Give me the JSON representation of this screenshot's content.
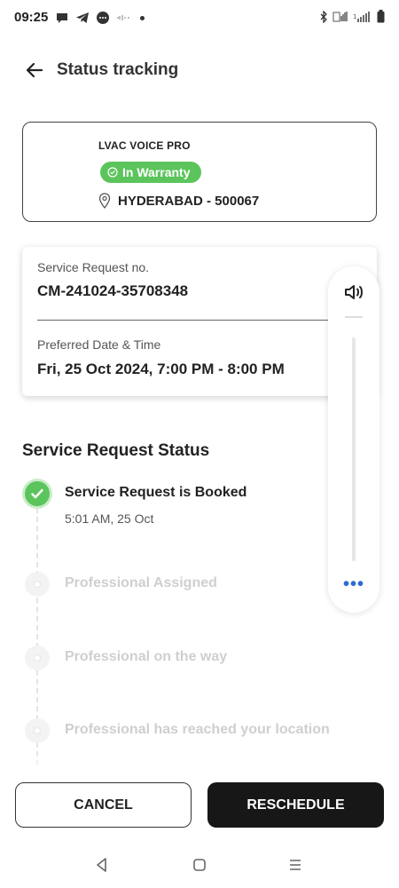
{
  "status_bar": {
    "time": "09:25",
    "icons": [
      "chat-bubble-icon",
      "telegram-icon",
      "messages-icon",
      "sound-wave-icon",
      "notification-dot-icon",
      "bluetooth-icon",
      "volte-icon",
      "signal-icon",
      "battery-icon"
    ]
  },
  "header": {
    "title": "Status tracking",
    "back_icon": "arrow-left-icon"
  },
  "product": {
    "name": "LVAC VOICE PRO",
    "warranty_label": "In Warranty",
    "location": "HYDERABAD - 500067"
  },
  "request": {
    "number_label": "Service Request no.",
    "number_value": "CM-241024-35708348",
    "datetime_label": "Preferred Date & Time",
    "datetime_value": "Fri, 25 Oct 2024, 7:00 PM - 8:00 PM"
  },
  "floating_toolbar": {
    "speaker_icon": "speaker-icon",
    "more_label": "•••"
  },
  "status_section": {
    "title": "Service Request Status",
    "steps": [
      {
        "title": "Service Request is Booked",
        "time": "5:01 AM, 25 Oct",
        "state": "done"
      },
      {
        "title": "Professional Assigned",
        "state": "pending"
      },
      {
        "title": "Professional on the way",
        "state": "pending"
      },
      {
        "title": "Professional has reached your location",
        "state": "pending"
      }
    ]
  },
  "actions": {
    "cancel_label": "CANCEL",
    "reschedule_label": "RESCHEDULE"
  },
  "colors": {
    "success_green": "#5cc45c",
    "primary_dark": "#171717",
    "link_blue": "#2e6ad6"
  }
}
